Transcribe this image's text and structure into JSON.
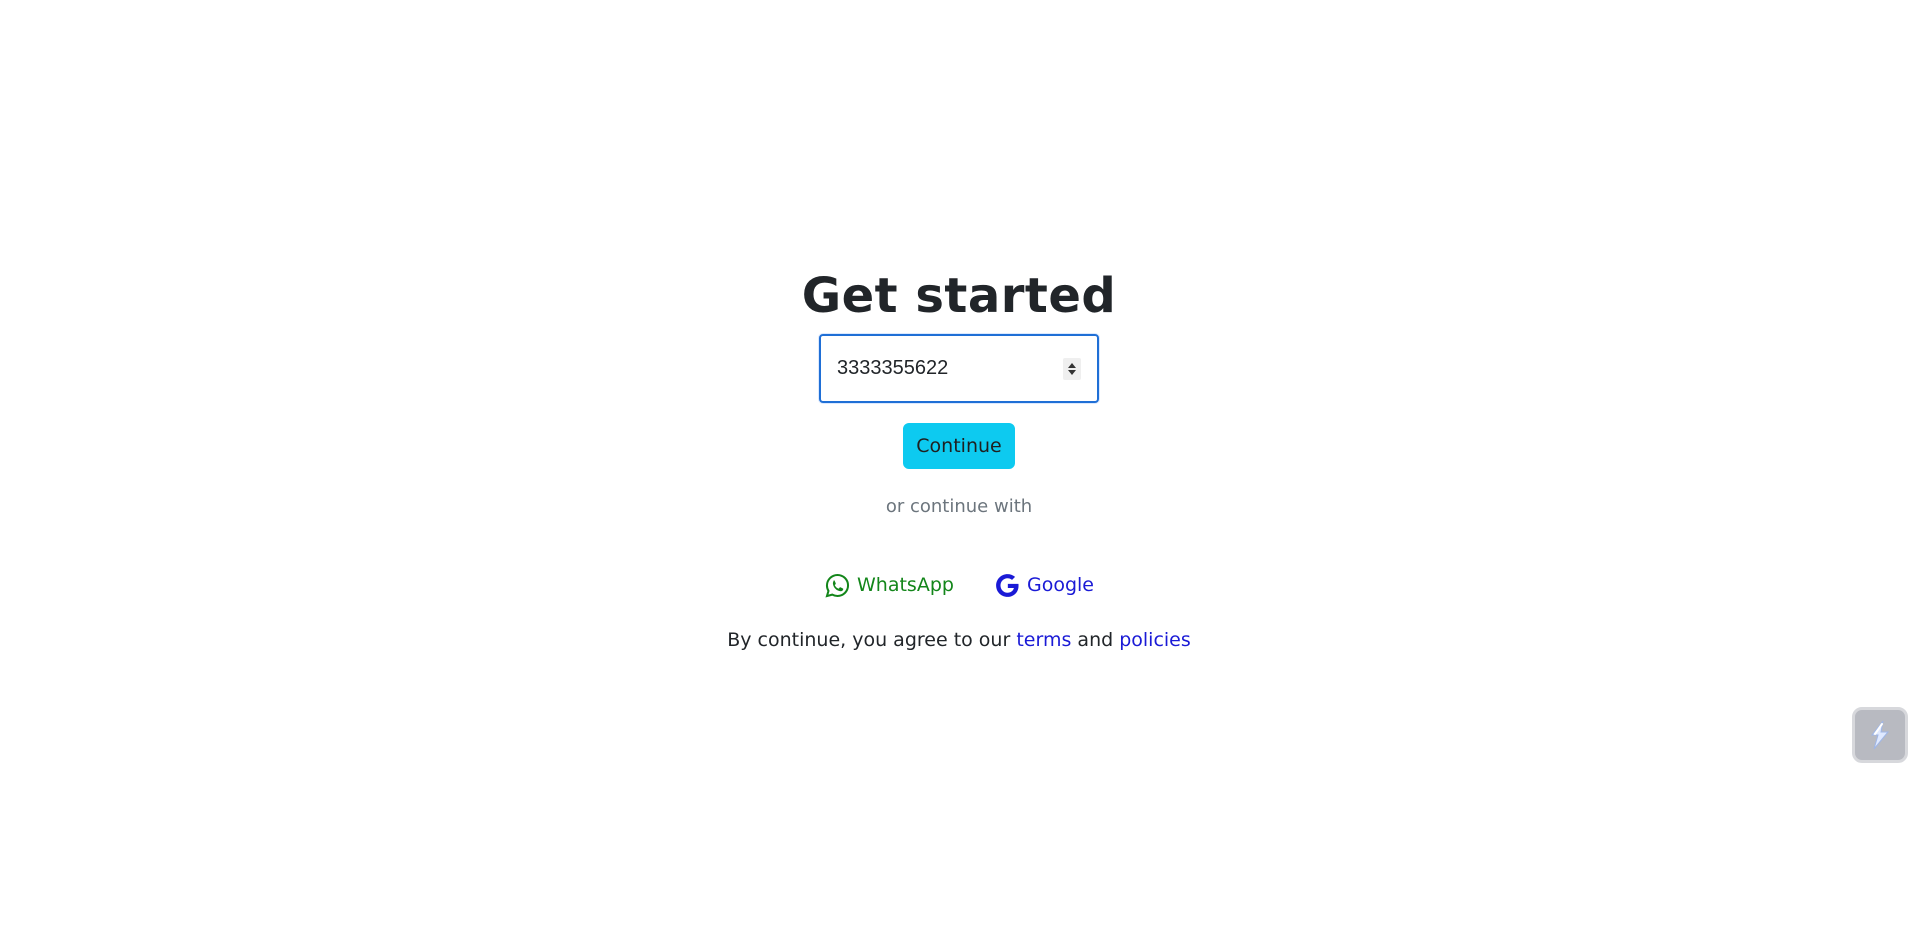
{
  "auth": {
    "title": "Get started",
    "phone_input": {
      "value": "3333355622",
      "type": "number"
    },
    "continue_label": "Continue",
    "divider_text": "or continue with",
    "social": {
      "whatsapp_label": "WhatsApp",
      "whatsapp_icon": "whatsapp-icon",
      "whatsapp_color": "#13861a",
      "google_label": "Google",
      "google_icon": "google-g-icon",
      "google_color": "#1a1ad6"
    },
    "terms": {
      "prefix": "By continue, you agree to our",
      "terms_link": "terms",
      "conjunction": "and",
      "policies_link": "policies"
    }
  },
  "widget": {
    "icon": "lightning-bolt-icon"
  },
  "colors": {
    "accent": "#0dcaf0",
    "focus_border": "#1f6fd6",
    "link": "#1a1ad6"
  }
}
